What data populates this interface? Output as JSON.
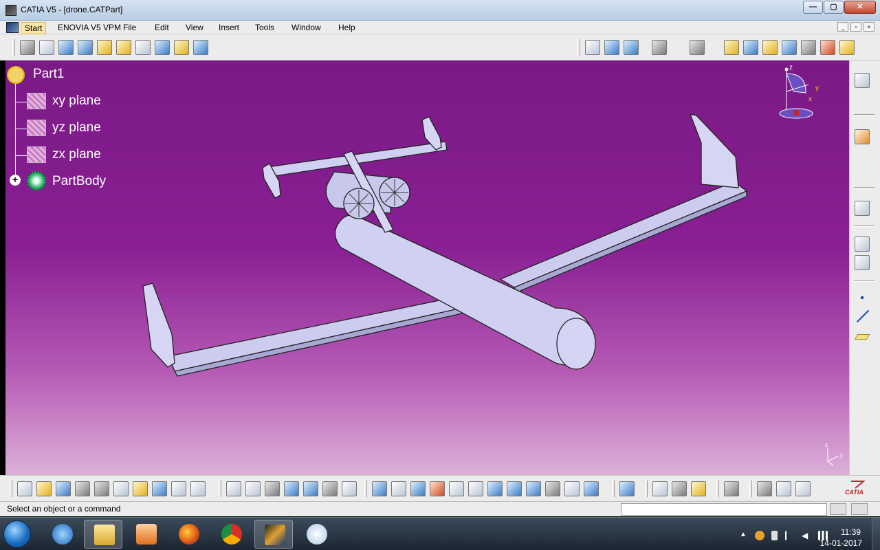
{
  "window": {
    "title": "CATIA V5 - [drone.CATPart]",
    "buttons": {
      "minimize": "—",
      "maximize": "▢",
      "close": "✕"
    }
  },
  "menu": {
    "items": [
      "Start",
      "ENOVIA V5 VPM",
      "File",
      "Edit",
      "View",
      "Insert",
      "Tools",
      "Window",
      "Help"
    ],
    "active": "Start"
  },
  "spec_tree": {
    "root": "Part1",
    "children": [
      "xy plane",
      "yz plane",
      "zx plane",
      "PartBody"
    ]
  },
  "compass": {
    "z": "z",
    "y": "y",
    "x": "x"
  },
  "mini_axes": {
    "z": "z",
    "y": "y"
  },
  "toolbars": {
    "top_left": [
      "sketch-icon",
      "pad-icon",
      "pocket-icon",
      "shaft-icon",
      "groove-icon",
      "fillet-icon",
      "chamfer-icon",
      "draft-icon",
      "shell-icon",
      "thickness-icon"
    ],
    "top_right": [
      "measure-icon",
      "analysis-icon",
      "grid-icon",
      "fit-all-icon",
      "settings-icon",
      "shading-icon",
      "edges-icon",
      "material-icon",
      "render-icon",
      "view-mode-icon",
      "target-icon",
      "apply-material-icon"
    ],
    "right": [
      "view-cube-icon",
      "select-arrow-icon",
      "sketch-edit-icon",
      "dimension-icon",
      "constraint-icon",
      "point-icon",
      "line-icon",
      "plane-icon"
    ],
    "bottom": [
      "new-icon",
      "open-icon",
      "save-icon",
      "print-icon",
      "cut-icon",
      "copy-icon",
      "paste-icon",
      "undo-icon",
      "redo-icon",
      "whats-this-icon",
      "formula-icon",
      "comment-icon",
      "lock-icon",
      "table-icon",
      "hierarchy-icon",
      "catalog-icon",
      "macro-icon",
      "fly-icon",
      "fit-all-icon",
      "pan-icon",
      "rotate-icon",
      "zoom-in-icon",
      "zoom-out-icon",
      "normal-view-icon",
      "quick-view-icon",
      "iso-view-icon",
      "hide-show-icon",
      "swap-space-icon",
      "shading-icon",
      "wireframe-icon",
      "update-icon",
      "measure-between-icon",
      "measure-item-icon",
      "measure-inertia-icon",
      "camera-icon",
      "reframe-icon",
      "hand-icon",
      "axis-icon"
    ]
  },
  "status": {
    "message": "Select an object or a command",
    "command_input": ""
  },
  "branding": {
    "logo_text": "CATIA"
  },
  "taskbar": {
    "apps": [
      "explorer-icon",
      "media-player-icon",
      "firefox-icon",
      "chrome-icon",
      "catia-icon",
      "paint-icon"
    ],
    "active_app": "catia-icon",
    "time": "11:39",
    "date": "14-01-2017"
  },
  "colors": {
    "viewport_top": "#7a1a86",
    "viewport_bottom": "#dcb0d8",
    "model_fill": "#ccccf0",
    "tree_text": "#ffffff"
  }
}
